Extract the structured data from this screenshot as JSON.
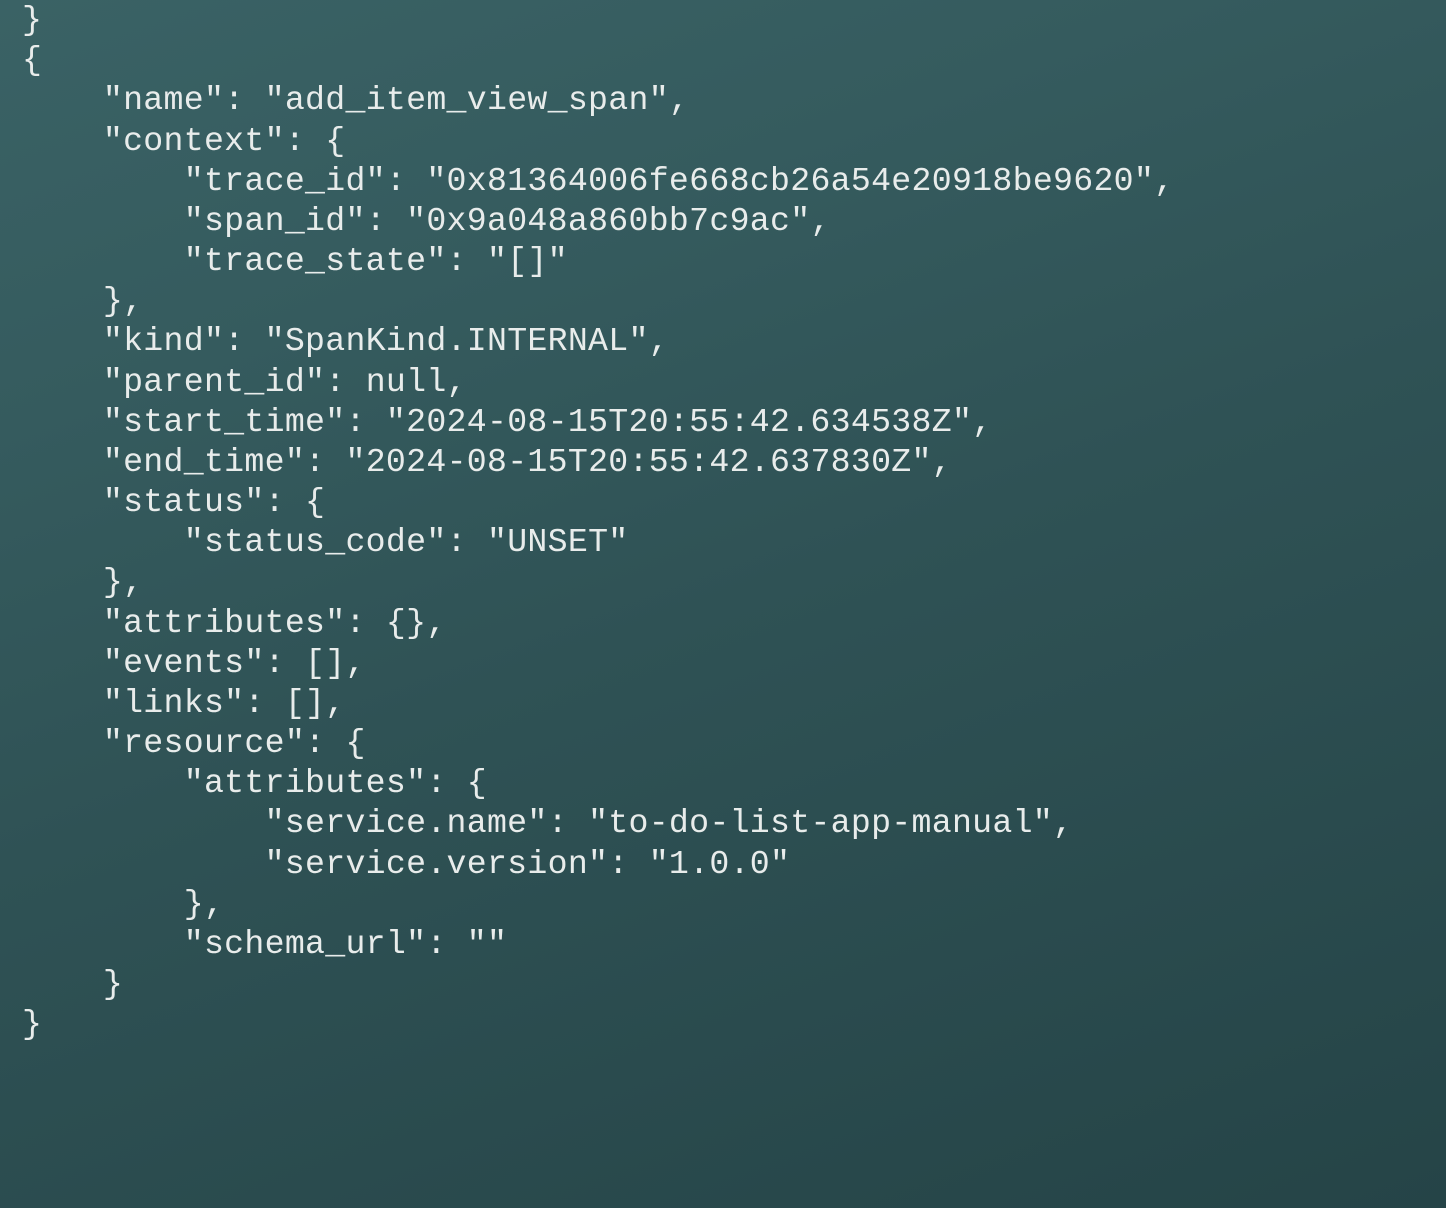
{
  "top_fragment": "}",
  "span": {
    "name_key": "\"name\"",
    "name_val": "\"add_item_view_span\"",
    "context_key": "\"context\"",
    "context": {
      "trace_id_key": "\"trace_id\"",
      "trace_id_val": "\"0x81364006fe668cb26a54e20918be9620\"",
      "span_id_key": "\"span_id\"",
      "span_id_val": "\"0x9a048a860bb7c9ac\"",
      "trace_state_key": "\"trace_state\"",
      "trace_state_val": "\"[]\""
    },
    "kind_key": "\"kind\"",
    "kind_val": "\"SpanKind.INTERNAL\"",
    "parent_id_key": "\"parent_id\"",
    "parent_id_val": "null",
    "start_time_key": "\"start_time\"",
    "start_time_val": "\"2024-08-15T20:55:42.634538Z\"",
    "end_time_key": "\"end_time\"",
    "end_time_val": "\"2024-08-15T20:55:42.637830Z\"",
    "status_key": "\"status\"",
    "status": {
      "status_code_key": "\"status_code\"",
      "status_code_val": "\"UNSET\""
    },
    "attributes_key": "\"attributes\"",
    "attributes_val": "{}",
    "events_key": "\"events\"",
    "events_val": "[]",
    "links_key": "\"links\"",
    "links_val": "[]",
    "resource_key": "\"resource\"",
    "resource": {
      "attributes_key": "\"attributes\"",
      "service_name_key": "\"service.name\"",
      "service_name_val": "\"to-do-list-app-manual\"",
      "service_version_key": "\"service.version\"",
      "service_version_val": "\"1.0.0\"",
      "schema_url_key": "\"schema_url\"",
      "schema_url_val": "\"\""
    }
  }
}
